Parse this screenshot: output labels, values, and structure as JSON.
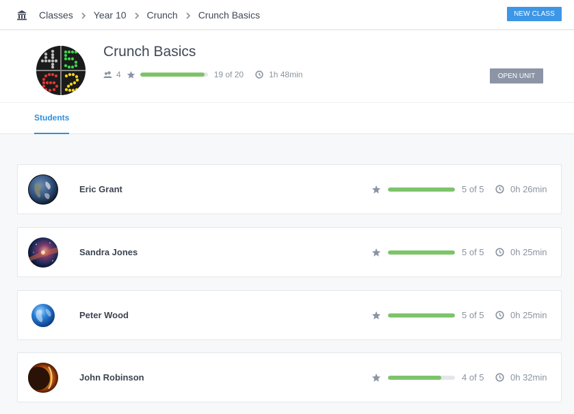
{
  "breadcrumb": {
    "home_icon": "bank-icon",
    "items": [
      "Classes",
      "Year 10",
      "Crunch",
      "Crunch Basics"
    ]
  },
  "header": {
    "new_class_label": "NEW CLASS"
  },
  "unit": {
    "title": "Crunch Basics",
    "students_count": "4",
    "progress_fraction": 0.95,
    "progress_text": "19 of 20",
    "time_text": "1h 48min",
    "open_unit_label": "OPEN UNIT"
  },
  "tabs": [
    {
      "label": "Students",
      "active": true
    }
  ],
  "students": [
    {
      "name": "Eric Grant",
      "avatar": "earth-avatar",
      "progress_fraction": 1.0,
      "progress_text": "5 of 5",
      "time_text": "0h 26min"
    },
    {
      "name": "Sandra Jones",
      "avatar": "galaxy-avatar",
      "progress_fraction": 1.0,
      "progress_text": "5 of 5",
      "time_text": "0h 25min"
    },
    {
      "name": "Peter Wood",
      "avatar": "globe-avatar",
      "progress_fraction": 1.0,
      "progress_text": "5 of 5",
      "time_text": "0h 25min"
    },
    {
      "name": "John Robinson",
      "avatar": "eclipse-avatar",
      "progress_fraction": 0.8,
      "progress_text": "4 of 5",
      "time_text": "0h 32min"
    }
  ],
  "colors": {
    "accent": "#3d96e6",
    "progress": "#7dc46b",
    "muted": "#8a93a0",
    "button_grey": "#8c95a6"
  }
}
